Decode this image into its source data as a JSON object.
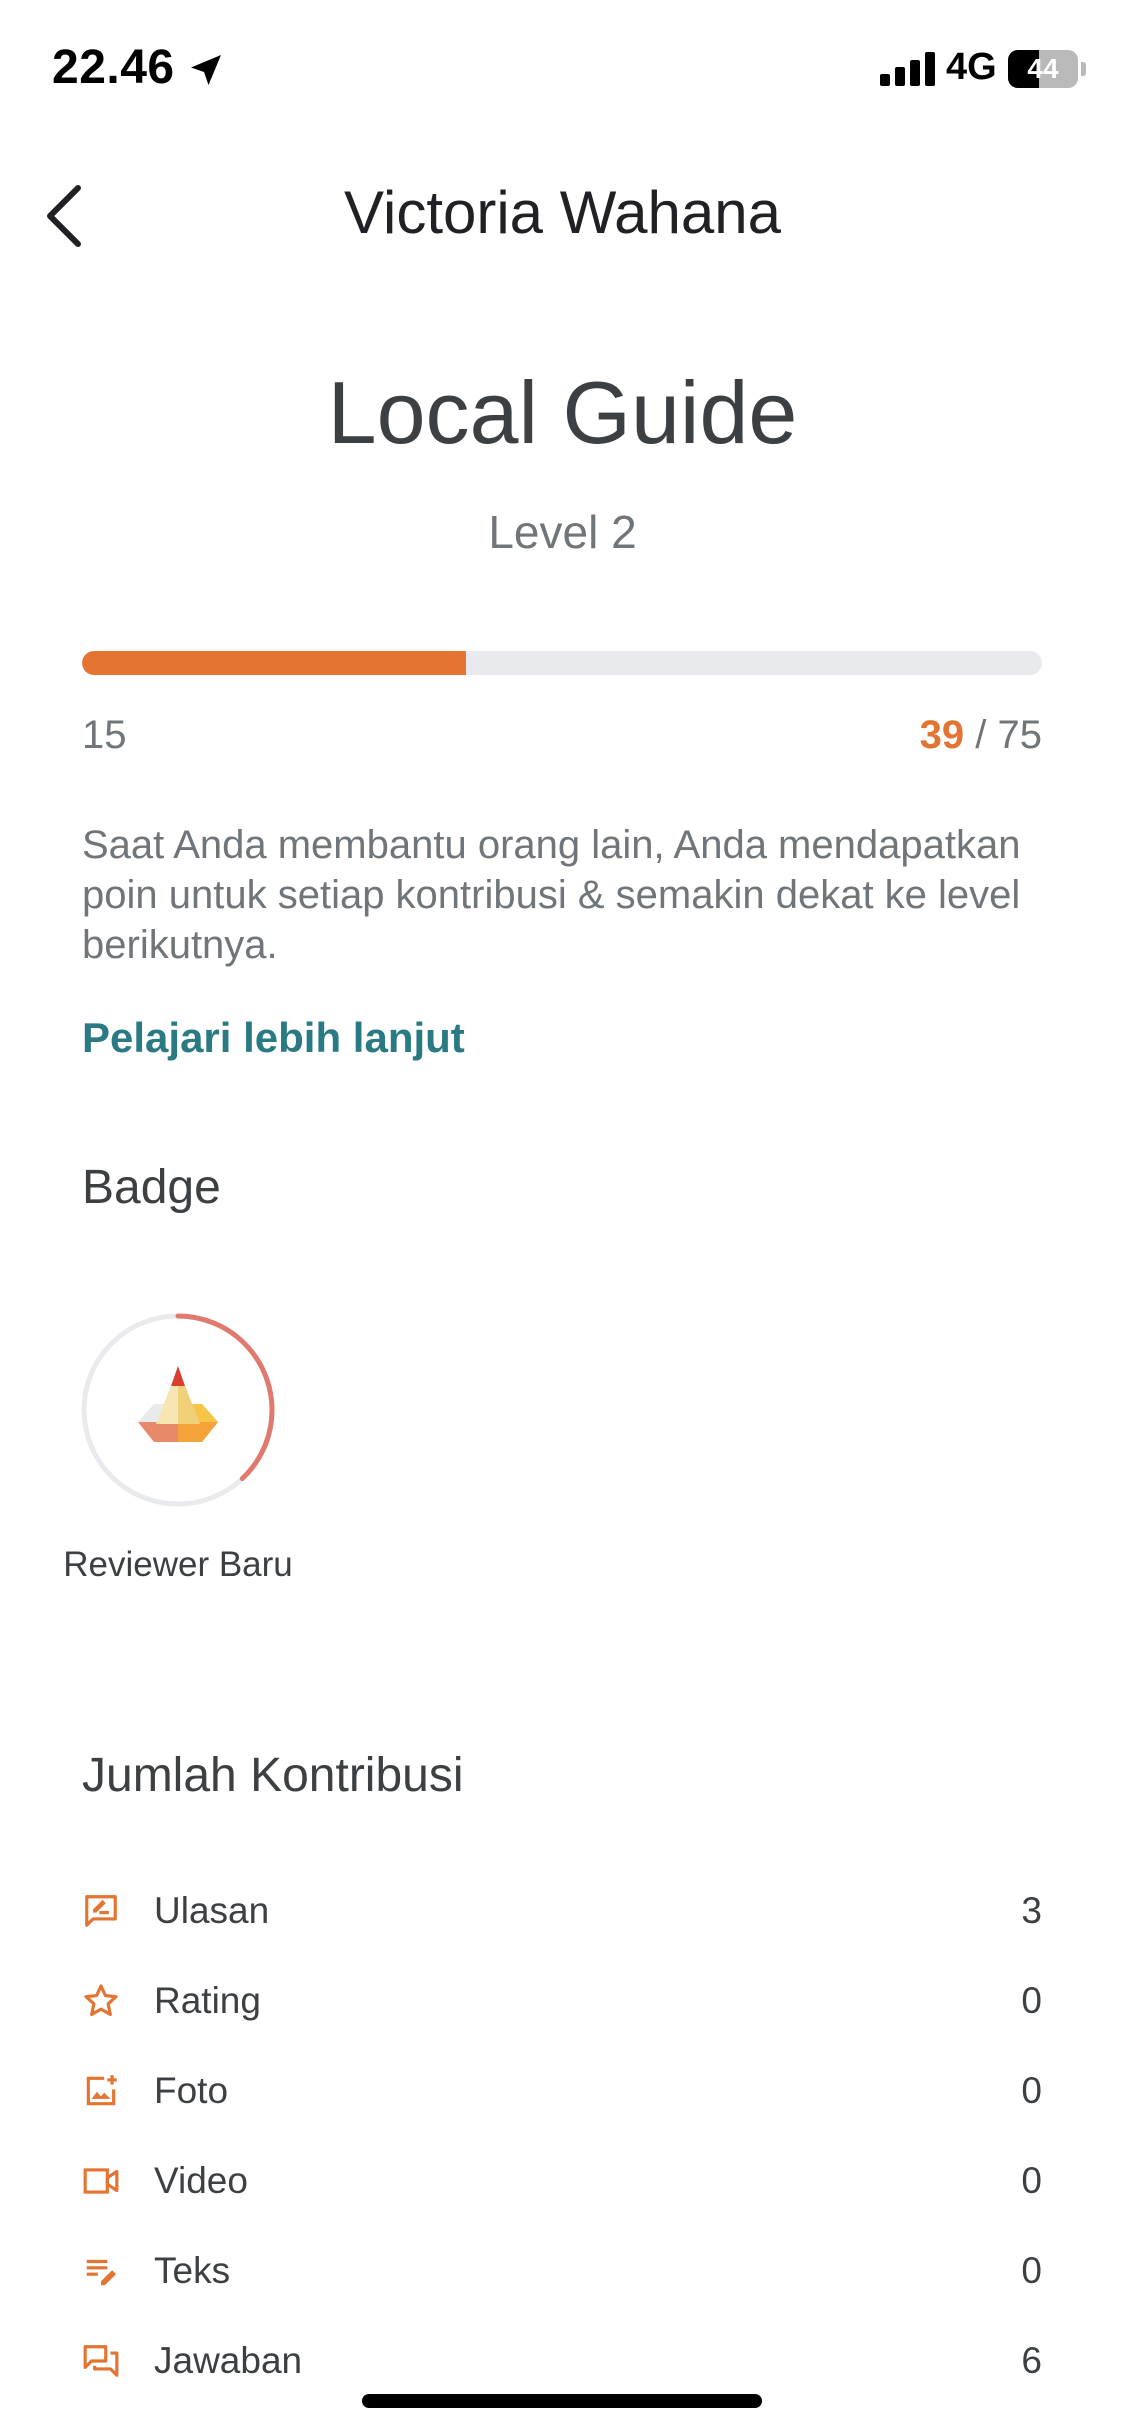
{
  "status_bar": {
    "time": "22.46",
    "network": "4G",
    "battery_text": "44",
    "battery_level": 0.44
  },
  "header": {
    "title": "Victoria Wahana",
    "back_icon": "chevron-left-icon"
  },
  "hero": {
    "title": "Local Guide",
    "level": "Level 2",
    "progress": {
      "min": "15",
      "current": "39",
      "max": " / 75",
      "fraction": 0.4
    },
    "description": "Saat Anda membantu orang lain, Anda mendapatkan poin untuk setiap kontribusi & semakin dekat ke level berikutnya.",
    "learn_more": "Pelajari lebih lanjut"
  },
  "badge_section": {
    "title": "Badge",
    "badge": {
      "label": "Reviewer Baru",
      "progress_fraction": 0.38,
      "icon": "pencil-badge-icon"
    }
  },
  "contrib_section": {
    "title": "Jumlah Kontribusi",
    "items": [
      {
        "label": "Ulasan",
        "count": "3",
        "icon": "review-icon"
      },
      {
        "label": "Rating",
        "count": "0",
        "icon": "star-icon"
      },
      {
        "label": "Foto",
        "count": "0",
        "icon": "add-photo-icon"
      },
      {
        "label": "Video",
        "count": "0",
        "icon": "video-icon"
      },
      {
        "label": "Teks",
        "count": "0",
        "icon": "edit-text-icon"
      },
      {
        "label": "Jawaban",
        "count": "6",
        "icon": "answers-icon"
      }
    ]
  },
  "colors": {
    "accent": "#e37432",
    "link": "#297a83",
    "badge_ring": "#e07a6e"
  }
}
